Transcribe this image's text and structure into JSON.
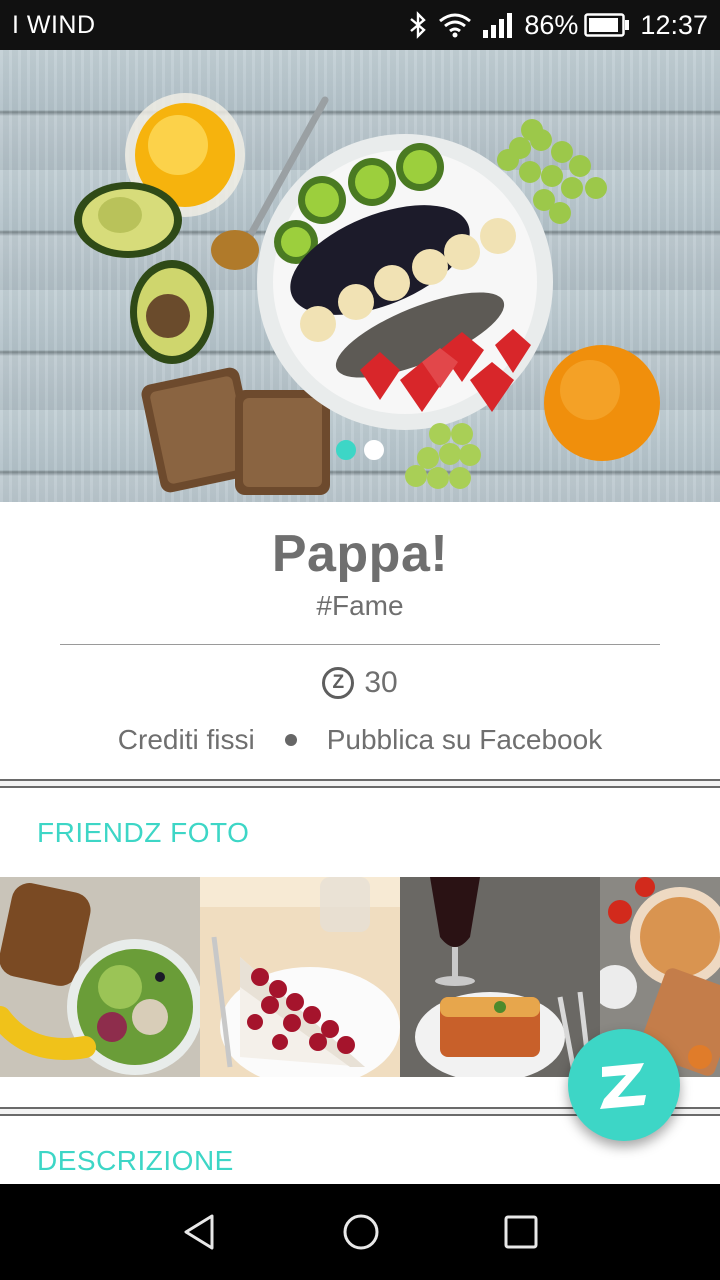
{
  "status_bar": {
    "carrier": "I WIND",
    "battery": "86%",
    "time": "12:37",
    "icons": [
      "bluetooth-icon",
      "wifi-icon",
      "signal-icon",
      "battery-icon"
    ]
  },
  "hero": {
    "slides_total": 2,
    "active_slide": 1
  },
  "product": {
    "title": "Pappa!",
    "hashtag": "#Fame",
    "credits_value": "30",
    "coin_symbol": "Z",
    "credit_type": "Crediti fissi",
    "publish_target": "Pubblica su Facebook"
  },
  "sections": {
    "photos_title": "FRIENDZ FOTO",
    "description_title": "DESCRIZIONE"
  },
  "photos": [
    "salad-photo",
    "cheesecake-photo",
    "lasagna-photo",
    "grilled-dish-photo"
  ],
  "colors": {
    "accent": "#3dd6c6",
    "text": "#6f6f6f",
    "status_bar": "#111111",
    "nav_bar": "#000000"
  }
}
